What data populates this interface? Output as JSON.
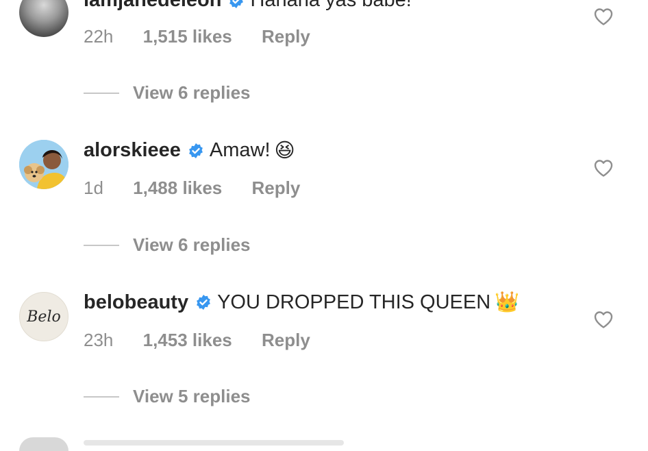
{
  "comments": [
    {
      "username": "iamjanedeleon",
      "text": "Hahaha yas babe!",
      "time": "22h",
      "likes": "1,515 likes",
      "reply": "Reply",
      "view_replies": "View 6 replies",
      "avatar": "user-photo-avatar"
    },
    {
      "username": "alorskieee",
      "text": "Amaw!",
      "emoji": "😆",
      "time": "1d",
      "likes": "1,488 likes",
      "reply": "Reply",
      "view_replies": "View 6 replies",
      "avatar": "user-with-dog-avatar"
    },
    {
      "username": "belobeauty",
      "text": "YOU DROPPED THIS QUEEN",
      "emoji": "👑",
      "time": "23h",
      "likes": "1,453 likes",
      "reply": "Reply",
      "view_replies": "View 5 replies",
      "avatar_logo": "Belo"
    }
  ],
  "colors": {
    "text": "#262626",
    "secondary": "#8e8e8e",
    "verified": "#3897f0"
  }
}
